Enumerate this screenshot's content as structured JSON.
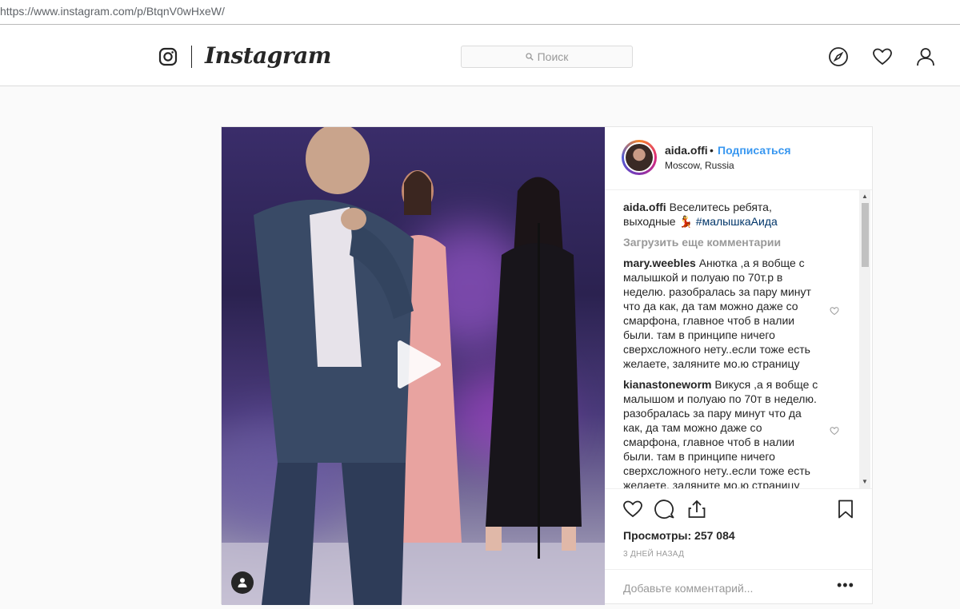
{
  "browser": {
    "url": "https://www.instagram.com/p/BtqnV0wHxeW/"
  },
  "nav": {
    "brand": "Instagram",
    "search_placeholder": "Поиск",
    "icons": [
      "camera-logo-icon",
      "compass-icon",
      "heart-icon",
      "person-icon"
    ]
  },
  "post": {
    "username": "aida.offi",
    "separator": "•",
    "follow_label": "Подписаться",
    "location": "Moscow, Russia",
    "caption": {
      "username": "aida.offi",
      "text": "Веселитесь ребята, выходные 💃",
      "hashtag": "#малышкаАида"
    },
    "load_more": "Загрузить еще комментарии",
    "comments": [
      {
        "username": "mary.weebles",
        "text": "Анютка ,а я вобще с малышкой и полуаю по 70т.р в неделю. разобралась за пару минут что да как, да там можно даже со смарфона, главное чтоб в налии были. там в принципе ничего сверхсложного нету..если тоже есть желаете, заляните мо.ю страницу"
      },
      {
        "username": "kianastoneworm",
        "text": "Викуся ,а я вобще с малышом и полуаю по 70т в неделю. разобралась за пару минут что да как, да там можно даже со смарфона, главное чтоб в налии были. там в принципе ничего сверхсложного нету..если тоже есть желаете, заляните мо.ю страницу"
      }
    ],
    "views": "Просмотры: 257 084",
    "time": "3 ДНЕЙ НАЗАД",
    "add_comment_placeholder": "Добавьте комментарий...",
    "more_label": "•••"
  },
  "colors": {
    "link_blue": "#3897f0",
    "hashtag": "#003569",
    "muted": "#999999",
    "text": "#262626"
  }
}
